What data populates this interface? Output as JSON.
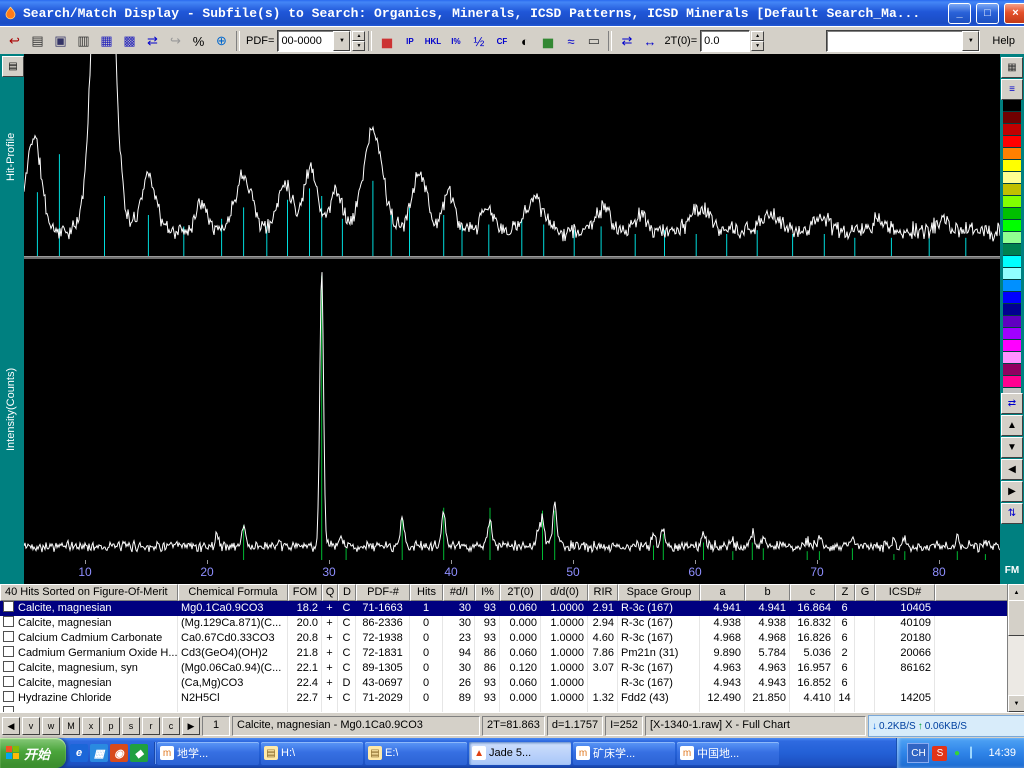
{
  "window": {
    "title": "Search/Match Display - Subfile(s) to Search: Organics, Minerals, ICSD Patterns, ICSD Minerals [Default Search_Ma...",
    "minimize_glyph": "_",
    "maximize_glyph": "□",
    "close_glyph": "×"
  },
  "icons": {
    "dropdown": "▼",
    "spinner_up": "▲",
    "spinner_down": "▼",
    "scroll_up": "▲",
    "scroll_down": "▼",
    "net_down": "↓",
    "net_up": "↑"
  },
  "toolbar": {
    "left_buttons": [
      {
        "name": "exit-button",
        "glyph": "↩",
        "color": "#aa0000"
      },
      {
        "name": "print-button",
        "glyph": "▤",
        "color": "#333333"
      },
      {
        "name": "save-button",
        "glyph": "▣",
        "color": "#333366"
      },
      {
        "name": "print-setup-button",
        "glyph": "▥",
        "color": "#333333"
      },
      {
        "name": "report-button",
        "glyph": "▦",
        "color": "#2222bb"
      },
      {
        "name": "grid-view-button",
        "glyph": "▩",
        "color": "#2222bb"
      },
      {
        "name": "sync-views-button",
        "glyph": "⇄",
        "color": "#0000cc"
      },
      {
        "name": "forward-button",
        "glyph": "↪",
        "color": "#999999"
      },
      {
        "name": "search-match-button",
        "glyph": "%",
        "color": "#000000"
      },
      {
        "name": "internet-button",
        "glyph": "⊕",
        "color": "#0066cc"
      }
    ],
    "pdf_label": "PDF=",
    "pdf_value": "00-0000",
    "mid_buttons": [
      {
        "name": "overlay-patterns-button",
        "glyph": "▅",
        "color": "#cc3333"
      },
      {
        "name": "ip-toggle-button",
        "glyph": "IP",
        "color": "#0000cc"
      },
      {
        "name": "hkl-toggle-button",
        "glyph": "HKL",
        "color": "#0000cc"
      },
      {
        "name": "i-percent-button",
        "glyph": "I%",
        "color": "#0000cc"
      },
      {
        "name": "half-width-button",
        "glyph": "½",
        "color": "#0000cc"
      },
      {
        "name": "cf-button",
        "glyph": "CF",
        "color": "#0000cc"
      },
      {
        "name": "invert-contrast-button",
        "glyph": "◐",
        "color": "#000000"
      },
      {
        "name": "stack-chart-button",
        "glyph": "▅",
        "color": "#338833"
      },
      {
        "name": "profile-fit-button",
        "glyph": "≈",
        "color": "#0000cc"
      },
      {
        "name": "zoom-rect-button",
        "glyph": "▭",
        "color": "#333333"
      }
    ],
    "nav_buttons": [
      {
        "name": "expand-axes-button",
        "glyph": "⇄",
        "color": "#0000cc"
      },
      {
        "name": "full-range-button",
        "glyph": "↔",
        "color": "#0000cc"
      }
    ],
    "two_theta_label": "2T(0)=",
    "two_theta_value": "0.0",
    "pattern_combo_value": "",
    "help_label": "Help"
  },
  "left_strip": {
    "button_glyph": "▤"
  },
  "right_strip": {
    "top_buttons": [
      {
        "name": "mini-chart-button",
        "glyph": "▦",
        "color": "#333333"
      },
      {
        "name": "line-style-button",
        "glyph": "≡",
        "color": "#0000cc"
      }
    ],
    "palette": [
      "#000000",
      "#700000",
      "#c00000",
      "#ff0000",
      "#ff8000",
      "#ffff00",
      "#ffff90",
      "#c0c000",
      "#80ff00",
      "#00c000",
      "#00ff00",
      "#90ff90",
      "#008050",
      "#00ffff",
      "#90ffff",
      "#0090ff",
      "#0000ff",
      "#000090",
      "#6000c0",
      "#a000ff",
      "#ff00ff",
      "#ff90ff",
      "#900060",
      "#ff0090",
      "#c0c0c0",
      "#505050"
    ],
    "arrow_buttons": [
      {
        "name": "swap-axes-button",
        "glyph": "⇄",
        "color": "#0000cc"
      },
      {
        "name": "pan-up-button",
        "glyph": "▲",
        "color": "#000000"
      },
      {
        "name": "pan-down-button",
        "glyph": "▼",
        "color": "#000000"
      },
      {
        "name": "pan-left-button",
        "glyph": "◀",
        "color": "#000000"
      },
      {
        "name": "pan-right-button",
        "glyph": "▶",
        "color": "#000000"
      },
      {
        "name": "fit-vertical-button",
        "glyph": "⇅",
        "color": "#0000cc"
      }
    ],
    "fm_label": "FM"
  },
  "chart_data": [
    {
      "type": "line",
      "panel": "top",
      "title": "Hit-Profile",
      "line_color": "#ffffff",
      "stick_color": "#00dddd",
      "x_min": 5,
      "x_max": 85,
      "ticks": [
        10,
        20,
        30,
        40,
        50,
        60,
        70,
        80
      ],
      "baseline": 0.06,
      "noise": 0.055,
      "seed": 11,
      "peaks": [
        [
          5.8,
          0.5,
          0.6
        ],
        [
          11.5,
          2.4,
          0.75
        ],
        [
          15.2,
          0.3,
          0.6
        ],
        [
          19.6,
          0.16,
          0.5
        ],
        [
          23.0,
          0.3,
          0.7
        ],
        [
          26.4,
          0.26,
          0.6
        ],
        [
          28.5,
          0.34,
          0.55
        ],
        [
          30.6,
          0.22,
          0.5
        ],
        [
          33.6,
          0.52,
          0.8
        ],
        [
          37.4,
          0.32,
          0.6
        ],
        [
          39.8,
          0.2,
          0.5
        ],
        [
          43.0,
          0.12,
          0.5
        ],
        [
          46.8,
          0.18,
          0.7
        ],
        [
          52.4,
          0.12,
          0.6
        ],
        [
          55.6,
          0.08,
          0.5
        ],
        [
          60.4,
          0.12,
          0.8
        ],
        [
          66.2,
          0.09,
          0.7
        ],
        [
          70.3,
          0.08,
          0.6
        ],
        [
          75.0,
          0.06,
          0.5
        ],
        [
          80.2,
          0.06,
          0.5
        ]
      ],
      "sticks": [
        [
          6.1,
          0.32
        ],
        [
          7.9,
          0.52
        ],
        [
          11.6,
          0.3
        ],
        [
          15.2,
          0.2
        ],
        [
          18.1,
          0.14
        ],
        [
          21.2,
          0.18
        ],
        [
          23.0,
          0.24
        ],
        [
          24.9,
          0.14
        ],
        [
          26.6,
          0.28
        ],
        [
          28.4,
          0.34
        ],
        [
          29.4,
          0.3
        ],
        [
          31.1,
          0.18
        ],
        [
          33.6,
          0.38
        ],
        [
          35.1,
          0.2
        ],
        [
          36.6,
          0.24
        ],
        [
          39.4,
          0.2
        ],
        [
          40.9,
          0.15
        ],
        [
          43.1,
          0.15
        ],
        [
          45.8,
          0.18
        ],
        [
          47.6,
          0.15
        ],
        [
          50.1,
          0.12
        ],
        [
          52.3,
          0.14
        ],
        [
          55.1,
          0.1
        ],
        [
          57.5,
          0.12
        ],
        [
          60.1,
          0.1
        ],
        [
          62.6,
          0.1
        ],
        [
          65.1,
          0.12
        ],
        [
          68.0,
          0.1
        ],
        [
          70.6,
          0.1
        ],
        [
          73.1,
          0.08
        ],
        [
          76.1,
          0.08
        ],
        [
          79.2,
          0.08
        ],
        [
          82.2,
          0.08
        ]
      ]
    },
    {
      "type": "line",
      "panel": "bottom",
      "title": "Intensity(Counts)",
      "line_color": "#ffffff",
      "stick_color": "#00bb33",
      "x_min": 5,
      "x_max": 85,
      "ticks": [
        10,
        20,
        30,
        40,
        50,
        60,
        70,
        80
      ],
      "baseline": 0.015,
      "noise": 0.022,
      "seed": 42,
      "peaks": [
        [
          20.8,
          0.04,
          0.15
        ],
        [
          23.0,
          0.07,
          0.16
        ],
        [
          29.4,
          0.95,
          0.15
        ],
        [
          31.0,
          0.03,
          0.15
        ],
        [
          36.0,
          0.1,
          0.16
        ],
        [
          39.4,
          0.12,
          0.16
        ],
        [
          43.2,
          0.1,
          0.16
        ],
        [
          47.1,
          0.05,
          0.15
        ],
        [
          47.5,
          0.1,
          0.16
        ],
        [
          48.5,
          0.14,
          0.17
        ],
        [
          56.6,
          0.04,
          0.16
        ],
        [
          57.4,
          0.07,
          0.16
        ],
        [
          60.7,
          0.04,
          0.15
        ],
        [
          63.0,
          0.02,
          0.15
        ],
        [
          64.7,
          0.05,
          0.16
        ],
        [
          65.6,
          0.03,
          0.15
        ],
        [
          69.2,
          0.02,
          0.15
        ],
        [
          70.2,
          0.03,
          0.15
        ],
        [
          72.9,
          0.03,
          0.16
        ],
        [
          76.3,
          0.02,
          0.15
        ],
        [
          77.2,
          0.02,
          0.15
        ],
        [
          81.5,
          0.03,
          0.16
        ],
        [
          83.8,
          0.02,
          0.15
        ]
      ],
      "sticks": [
        [
          23.0,
          0.11
        ],
        [
          29.4,
          0.97
        ],
        [
          31.4,
          0.03
        ],
        [
          36.0,
          0.13
        ],
        [
          39.4,
          0.17
        ],
        [
          43.2,
          0.17
        ],
        [
          47.5,
          0.16
        ],
        [
          48.5,
          0.16
        ],
        [
          56.6,
          0.04
        ],
        [
          57.4,
          0.08
        ],
        [
          60.7,
          0.05
        ],
        [
          63.1,
          0.02
        ],
        [
          64.7,
          0.05
        ],
        [
          65.6,
          0.03
        ],
        [
          69.2,
          0.02
        ],
        [
          70.2,
          0.02
        ],
        [
          72.9,
          0.03
        ],
        [
          76.3,
          0.01
        ],
        [
          77.2,
          0.02
        ],
        [
          81.5,
          0.02
        ],
        [
          83.8,
          0.01
        ]
      ]
    }
  ],
  "table": {
    "columns": [
      "40 Hits Sorted on Figure-Of-Merit",
      "Chemical Formula",
      "FOM",
      "Q",
      "D",
      "PDF-#",
      "Hits",
      "#d/I",
      "I%",
      "2T(0)",
      "d/d(0)",
      "RIR",
      "Space Group",
      "a",
      "b",
      "c",
      "Z",
      "G",
      "ICSD#"
    ],
    "selected_row": 0,
    "rows": [
      [
        "Calcite, magnesian",
        "Mg0.1Ca0.9CO3",
        "18.2",
        "+",
        "C",
        "71-1663",
        "1",
        "30",
        "93",
        "0.060",
        "1.0000",
        "2.91",
        "R-3c (167)",
        "4.941",
        "4.941",
        "16.864",
        "6",
        "",
        "10405"
      ],
      [
        "Calcite, magnesian",
        "(Mg.129Ca.871)(C...",
        "20.0",
        "+",
        "C",
        "86-2336",
        "0",
        "30",
        "93",
        "0.000",
        "1.0000",
        "2.94",
        "R-3c (167)",
        "4.938",
        "4.938",
        "16.832",
        "6",
        "",
        "40109"
      ],
      [
        "Calcium Cadmium Carbonate",
        "Ca0.67Cd0.33CO3",
        "20.8",
        "+",
        "C",
        "72-1938",
        "0",
        "23",
        "93",
        "0.000",
        "1.0000",
        "4.60",
        "R-3c (167)",
        "4.968",
        "4.968",
        "16.826",
        "6",
        "",
        "20180"
      ],
      [
        "Cadmium Germanium Oxide H...",
        "Cd3(GeO4)(OH)2",
        "21.8",
        "+",
        "C",
        "72-1831",
        "0",
        "94",
        "86",
        "0.060",
        "1.0000",
        "7.86",
        "Pm21n (31)",
        "9.890",
        "5.784",
        "5.036",
        "2",
        "",
        "20066"
      ],
      [
        "Calcite, magnesium, syn",
        "(Mg0.06Ca0.94)(C...",
        "22.1",
        "+",
        "C",
        "89-1305",
        "0",
        "30",
        "86",
        "0.120",
        "1.0000",
        "3.07",
        "R-3c (167)",
        "4.963",
        "4.963",
        "16.957",
        "6",
        "",
        "86162"
      ],
      [
        "Calcite, magnesian",
        "(Ca,Mg)CO3",
        "22.4",
        "+",
        "D",
        "43-0697",
        "0",
        "26",
        "93",
        "0.060",
        "1.0000",
        "",
        "R-3c (167)",
        "4.943",
        "4.943",
        "16.852",
        "6",
        "",
        ""
      ],
      [
        "Hydrazine Chloride",
        "N2H5Cl",
        "22.7",
        "+",
        "C",
        "71-2029",
        "0",
        "89",
        "93",
        "0.000",
        "1.0000",
        "1.32",
        "Fdd2 (43)",
        "12.490",
        "21.850",
        "4.410",
        "14",
        "",
        "14205"
      ],
      [
        "",
        "",
        "",
        "",
        "",
        "",
        "",
        "",
        "",
        "",
        "",
        "",
        "",
        "",
        "",
        "",
        "",
        "",
        ""
      ]
    ]
  },
  "status_bar": {
    "nav_prev_glyph": "◀",
    "letter_buttons": [
      "v",
      "w",
      "M",
      "x",
      "p",
      "s",
      "r",
      "c"
    ],
    "nav_next_glyph": "▶",
    "index_value": "1",
    "selection_text": "Calcite, magnesian - Mg0.1Ca0.9CO3",
    "two_theta_readout": "2T=81.863",
    "d_readout": "d=1.1757",
    "i_readout": "I=252",
    "file_readout": "[X-1340-1.raw] X - Full Chart",
    "net_down_value": "0.2KB/S",
    "net_up_value": "0.06KB/S"
  },
  "taskbar": {
    "start_label": "开始",
    "quick_launch": [
      {
        "name": "quicklaunch-ie-icon",
        "glyph": "e",
        "bg": "#1b66d8",
        "color": "#ffffff"
      },
      {
        "name": "quicklaunch-desktop-icon",
        "glyph": "▦",
        "bg": "#2a8ae0",
        "color": "#ffffff"
      },
      {
        "name": "quicklaunch-media-icon",
        "glyph": "◉",
        "bg": "#d84a1b",
        "color": "#ffffff"
      },
      {
        "name": "quicklaunch-messenger-icon",
        "glyph": "◆",
        "bg": "#20a040",
        "color": "#ffffff"
      }
    ],
    "buttons": [
      {
        "name": "task-button-geology",
        "icon_name": "m-browser-icon",
        "icon_glyph": "m",
        "icon_bg": "#ffffff",
        "icon_color": "#e07820",
        "label": "地学...",
        "active": false
      },
      {
        "name": "task-button-h-drive",
        "icon_name": "drive-icon",
        "icon_glyph": "▤",
        "icon_bg": "#ffe9a8",
        "icon_color": "#806020",
        "label": "H:\\",
        "active": false
      },
      {
        "name": "task-button-e-drive",
        "icon_name": "drive-icon",
        "icon_glyph": "▤",
        "icon_bg": "#ffe9a8",
        "icon_color": "#806020",
        "label": "E:\\",
        "active": false
      },
      {
        "name": "task-button-jade",
        "icon_name": "jade-flame-icon",
        "icon_glyph": "▲",
        "icon_bg": "#ffffff",
        "icon_color": "#e04010",
        "label": "Jade 5...",
        "active": true
      },
      {
        "name": "task-button-ore-deposits",
        "icon_name": "m-browser-icon",
        "icon_glyph": "m",
        "icon_bg": "#ffffff",
        "icon_color": "#e07820",
        "label": "矿床学...",
        "active": false
      },
      {
        "name": "task-button-china-geology",
        "icon_name": "m-browser-icon",
        "icon_glyph": "m",
        "icon_bg": "#ffffff",
        "icon_color": "#e07820",
        "label": "中国地...",
        "active": false
      }
    ],
    "language_indicator": "CH",
    "tray_icons": [
      {
        "name": "sogou-tray-icon",
        "glyph": "S",
        "bg": "#e23418",
        "color": "#ffffff"
      },
      {
        "name": "antivirus-tray-icon",
        "glyph": "●",
        "bg": "transparent",
        "color": "#35d435"
      },
      {
        "name": "network-tray-icon",
        "glyph": "▎",
        "bg": "transparent",
        "color": "#9fd8ff"
      }
    ],
    "clock": "14:39"
  }
}
